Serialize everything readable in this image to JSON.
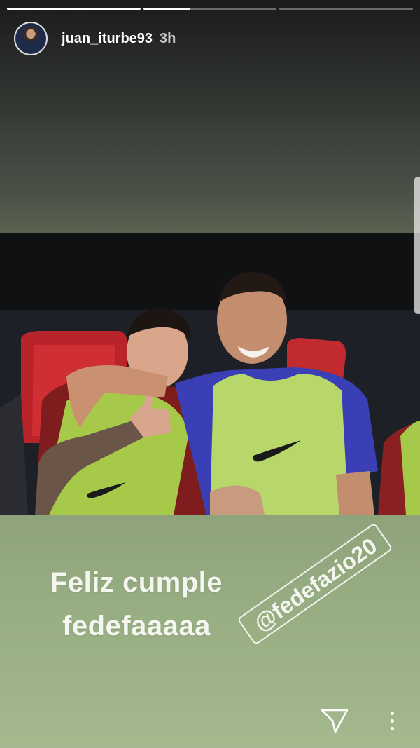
{
  "story": {
    "progress": [
      1.0,
      0.35,
      0.0
    ],
    "user": {
      "username": "juan_iturbe93",
      "time": "3h"
    },
    "caption": {
      "line1": "Feliz cumple",
      "line2": "fedefaaaaa"
    },
    "mention": "@fedefazio20"
  },
  "icons": {
    "send": "paper-plane-icon",
    "more": "vertical-dots-icon"
  },
  "colors": {
    "bottom_background": "#97ad82",
    "top_background": "#2f332f",
    "text": "#f4f6ef"
  }
}
